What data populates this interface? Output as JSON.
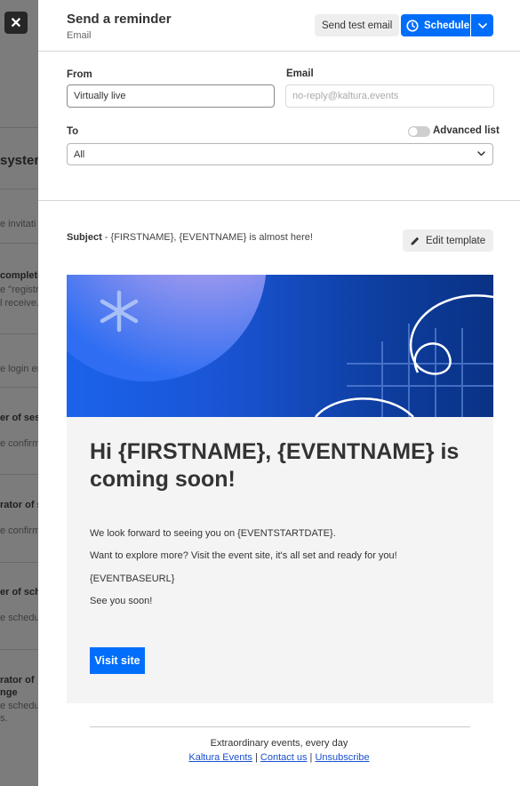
{
  "background": {
    "items": [
      {
        "text": "system",
        "style": "big",
        "top": 0
      },
      {
        "text": "e invitati",
        "style": "",
        "top": 0
      },
      {
        "text": "complete",
        "style": "b",
        "top": 0
      },
      {
        "text": "e \"registr",
        "style": "",
        "top": 0
      },
      {
        "text": "l receive.",
        "style": "",
        "top": 0
      },
      {
        "text": "e login en",
        "style": "",
        "top": 0
      },
      {
        "text": "er of sess",
        "style": "b",
        "top": 0
      },
      {
        "text": "e confirm",
        "style": "",
        "top": 0
      },
      {
        "text": "rator of se",
        "style": "b",
        "top": 0
      },
      {
        "text": "e confirm",
        "style": "",
        "top": 0
      },
      {
        "text": "er of sche",
        "style": "b",
        "top": 0
      },
      {
        "text": "e schedu",
        "style": "",
        "top": 0
      },
      {
        "text": "rator of",
        "style": "b",
        "top": 0
      },
      {
        "text": "nge",
        "style": "b",
        "top": 0
      },
      {
        "text": "e schedu",
        "style": "",
        "top": 0
      },
      {
        "text": "s.",
        "style": "",
        "top": 0
      }
    ]
  },
  "close_icon": "✕",
  "header": {
    "title": "Send a reminder",
    "subtitle": "Email",
    "test_button": "Send test email",
    "schedule_button": "Schedule"
  },
  "form": {
    "from_label": "From",
    "from_value": "Virtually live",
    "email_label": "Email",
    "email_placeholder": "no-reply@kaltura.events",
    "to_label": "To",
    "to_value": "All",
    "advanced_label": "Advanced list"
  },
  "subject": {
    "label": "Subject",
    "separator": " - ",
    "value": "{FIRSTNAME}, {EVENTNAME} is almost here!",
    "edit_button": "Edit template"
  },
  "email": {
    "heading": "Hi {FIRSTNAME}, {EVENTNAME} is coming soon!",
    "lines": [
      "We look forward to seeing you on {EVENTSTARTDATE}.",
      "Want to explore more? Visit the event site, it's all set and ready for you!",
      "{EVENTBASEURL}",
      "See you soon!"
    ],
    "button": "Visit site",
    "footer_tagline": "Extraordinary events, every day",
    "footer_links": [
      "Kaltura Events",
      "Contact us",
      "Unsubscribe"
    ],
    "footer_sep": " | "
  },
  "colors": {
    "primary": "#006efa",
    "overlay": "#7c7c7c"
  }
}
